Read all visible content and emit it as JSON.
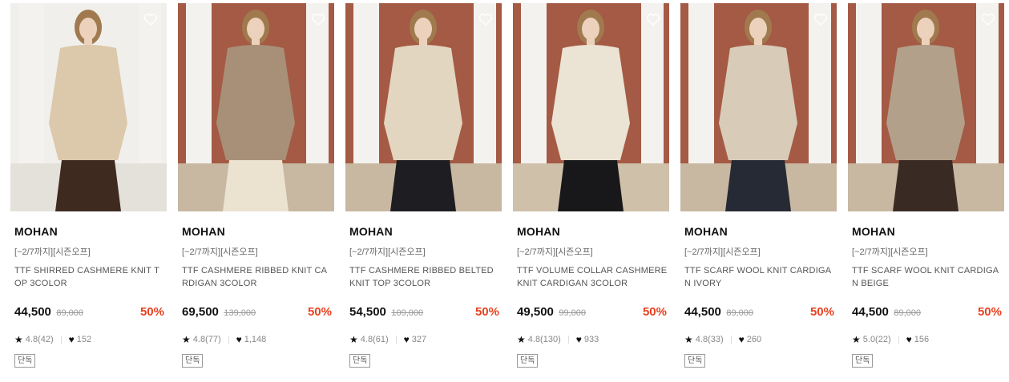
{
  "products": [
    {
      "brand": "MOHAN",
      "promo": "[~2/7까지][시즌오프]",
      "name": "TTF SHIRRED CASHMERE KNIT TOP 3COLOR",
      "price": "44,500",
      "original_price": "89,000",
      "discount": "50%",
      "rating": "4.8(42)",
      "likes": "152",
      "badge": "단독",
      "colors": {
        "wall": "#f0efec",
        "top": "#dcc8aa",
        "bottom": "#3f2a1f",
        "floor": "#e4e0da"
      }
    },
    {
      "brand": "MOHAN",
      "promo": "[~2/7까지][시즌오프]",
      "name": "TTF CASHMERE RIBBED KNIT CARDIGAN 3COLOR",
      "price": "69,500",
      "original_price": "139,000",
      "discount": "50%",
      "rating": "4.8(77)",
      "likes": "1,148",
      "badge": "단독",
      "colors": {
        "wall": "#a45a44",
        "top": "#a89078",
        "bottom": "#ece2d0",
        "floor": "#c8b8a2"
      }
    },
    {
      "brand": "MOHAN",
      "promo": "[~2/7까지][시즌오프]",
      "name": "TTF CASHMERE RIBBED BELTED KNIT TOP 3COLOR",
      "price": "54,500",
      "original_price": "109,000",
      "discount": "50%",
      "rating": "4.8(61)",
      "likes": "327",
      "badge": "단독",
      "colors": {
        "wall": "#a45a44",
        "top": "#e3d6c0",
        "bottom": "#1e1e22",
        "floor": "#c8b8a2"
      }
    },
    {
      "brand": "MOHAN",
      "promo": "[~2/7까지][시즌오프]",
      "name": "TTF VOLUME COLLAR CASHMERE KNIT CARDIGAN 3COLOR",
      "price": "49,500",
      "original_price": "99,000",
      "discount": "50%",
      "rating": "4.8(130)",
      "likes": "933",
      "badge": "단독",
      "colors": {
        "wall": "#a45a44",
        "top": "#ebe3d3",
        "bottom": "#18181a",
        "floor": "#cfc0aa"
      }
    },
    {
      "brand": "MOHAN",
      "promo": "[~2/7까지][시즌오프]",
      "name": "TTF SCARF WOOL KNIT CARDIGAN IVORY",
      "price": "44,500",
      "original_price": "89,000",
      "discount": "50%",
      "rating": "4.8(33)",
      "likes": "260",
      "badge": "단독",
      "colors": {
        "wall": "#a45a44",
        "top": "#d8cbb8",
        "bottom": "#262a34",
        "floor": "#c8b8a2"
      }
    },
    {
      "brand": "MOHAN",
      "promo": "[~2/7까지][시즌오프]",
      "name": "TTF SCARF WOOL KNIT CARDIGAN BEIGE",
      "price": "44,500",
      "original_price": "89,000",
      "discount": "50%",
      "rating": "5.0(22)",
      "likes": "156",
      "badge": "단독",
      "colors": {
        "wall": "#a45a44",
        "top": "#b3a08a",
        "bottom": "#3a2a24",
        "floor": "#c8b8a2"
      }
    }
  ],
  "icons": {
    "wishlist": "heart-outline-icon",
    "rating": "star-icon",
    "likes": "heart-filled-icon"
  },
  "accent_color": "#e8411f"
}
